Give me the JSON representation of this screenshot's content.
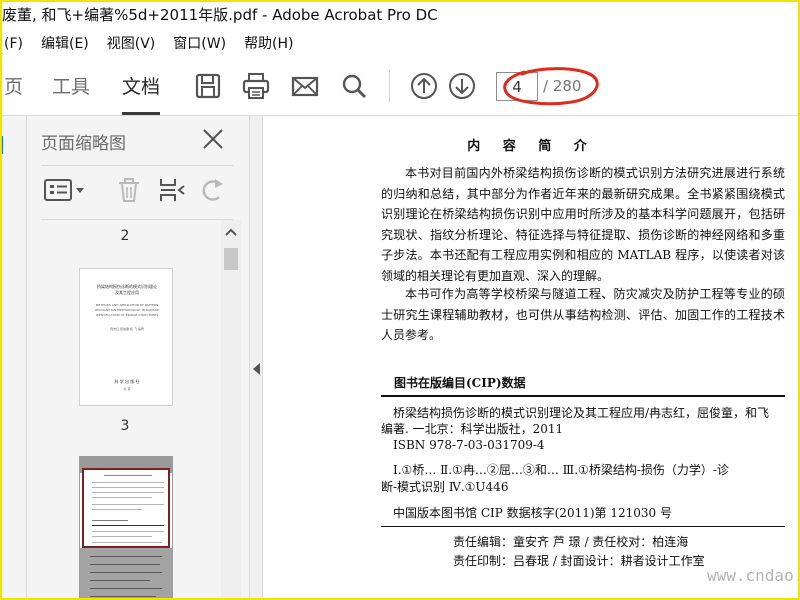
{
  "window": {
    "title": "废董, 和飞+编著%5d+2011年版.pdf - Adobe Acrobat Pro DC"
  },
  "menu": {
    "items": [
      "(F)",
      "编辑(E)",
      "视图(V)",
      "窗口(W)",
      "帮助(H)"
    ]
  },
  "toolbar": {
    "tabs": [
      "页",
      "工具",
      "文档"
    ],
    "active_tab": "文档",
    "icons": [
      "save-icon",
      "print-icon",
      "email-icon",
      "search-icon",
      "page-up-icon",
      "page-down-icon"
    ],
    "page_current": "4",
    "page_total": "/ 280"
  },
  "panel": {
    "title": "页面缩略图",
    "tools": [
      "thumbnail-options-icon",
      "delete-icon",
      "insert-page-icon",
      "rotate-icon"
    ],
    "page_labels": [
      "2",
      "3"
    ],
    "thumb1": {
      "title_line1": "桥梁结构损伤诊断的模式识别理论",
      "title_line2": "及其工程应用",
      "en_line1": "METHODS AND APPLICATION OF PATTERN",
      "en_line2": "RECOGNITION METHODOLOGY IN DAMAGE",
      "en_line3": "IDENTIFICATION OF BRIDGE STRUCTURES",
      "authors": "冉志红  屈俊童  和  飞  编著",
      "publisher": "科 学 出 版 社",
      "city": "北  京"
    }
  },
  "document": {
    "title": "内 容 简 介",
    "para1": "本书对目前国内外桥梁结构损伤诊断的模式识别方法研究进展进行系统的归纳和总结，其中部分为作者近年来的最新研究成果。全书紧紧围绕模式识别理论在桥梁结构损伤识别中应用时所涉及的基本科学问题展开，包括研究现状、指纹分析理论、特征选择与特征提取、损伤诊断的神经网络和多重子步法。本书还配有工程应用实例和相应的 MATLAB 程序，以使读者对该领域的相关理论有更加直观、深入的理解。",
    "para2": "本书可作为高等学校桥梁与隧道工程、防灾减灾及防护工程等专业的硕士研究生课程辅助教材，也可供从事结构检测、评估、加固工作的工程技术人员参考。",
    "cip_heading": "图书在版编目(CIP)数据",
    "cip_line1": "桥梁结构损伤诊断的模式识别理论及其工程应用/冉志红，屈俊童，和飞",
    "cip_line2": "编著. 一北京：科学出版社，2011",
    "cip_isbn": "ISBN 978-7-03-031709-4",
    "cip_class1": "Ⅰ.①桥…   Ⅱ.①冉…②屈…③和…   Ⅲ.①桥梁结构-损伤（力学）-诊",
    "cip_class2": "断-模式识别   Ⅳ.①U446",
    "cip_number": "中国版本图书馆 CIP 数据核字(2011)第 121030 号",
    "resp1": "责任编辑：童安齐   芦   璟 / 责任校对：柏连海",
    "resp2": "责任印制：吕春珉 / 封面设计：耕者设计工作室",
    "watermark": "www.cndao.com"
  }
}
